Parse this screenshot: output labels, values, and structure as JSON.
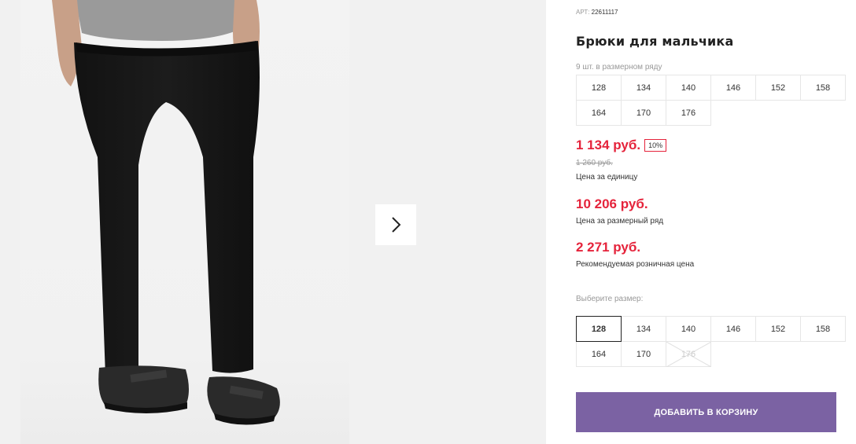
{
  "product": {
    "article_label": "АРТ:",
    "article_number": "22611117",
    "title": "Брюки для мальчика",
    "row_count_text": "9 шт. в размерном ряду"
  },
  "size_row": [
    "128",
    "134",
    "140",
    "146",
    "152",
    "158",
    "164",
    "170",
    "176"
  ],
  "pricing": {
    "unit_price": "1 134 руб.",
    "discount": "10%",
    "old_price": "1 260 руб.",
    "unit_caption": "Цена за единицу",
    "row_price": "10 206 руб.",
    "row_caption": "Цена за размерный ряд",
    "retail_price": "2 271 руб.",
    "retail_caption": "Рекомендуемая розничная цена"
  },
  "size_picker": {
    "label": "Выберите размер:",
    "sizes": [
      {
        "label": "128",
        "state": "selected"
      },
      {
        "label": "134",
        "state": "available"
      },
      {
        "label": "140",
        "state": "available"
      },
      {
        "label": "146",
        "state": "available"
      },
      {
        "label": "152",
        "state": "available"
      },
      {
        "label": "158",
        "state": "available"
      },
      {
        "label": "164",
        "state": "available"
      },
      {
        "label": "170",
        "state": "available"
      },
      {
        "label": "176",
        "state": "unavailable"
      }
    ]
  },
  "actions": {
    "add_to_cart": "ДОБАВИТЬ В КОРЗИНУ"
  },
  "gallery": {
    "next_icon": "chevron-right-icon"
  },
  "colors": {
    "price_red": "#e5233b",
    "button_purple": "#7b62a3"
  }
}
